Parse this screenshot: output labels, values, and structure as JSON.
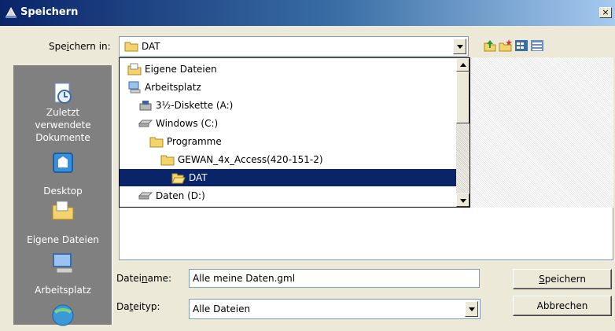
{
  "window": {
    "title": "Speichern",
    "close_glyph": "×",
    "accent_color": "#0a246a"
  },
  "save_in": {
    "label_pre": "Spe",
    "label_key": "i",
    "label_post": "chern in:",
    "current": "DAT"
  },
  "toolbar": {
    "icons": [
      "up-one-level-icon",
      "new-folder-icon",
      "view-menu-icon",
      "view-list-icon"
    ]
  },
  "dropdown": {
    "items": [
      {
        "label": "Eigene Dateien",
        "icon": "my-documents-icon"
      },
      {
        "label": "Arbeitsplatz",
        "icon": "my-computer-icon"
      },
      {
        "label": "3½-Diskette (A:)",
        "icon": "floppy-drive-icon"
      },
      {
        "label": "Windows (C:)",
        "icon": "hard-drive-icon"
      },
      {
        "label": "Programme",
        "icon": "folder-icon"
      },
      {
        "label": "GEWAN_4x_Access(420-151-2)",
        "icon": "folder-icon"
      },
      {
        "label": "DAT",
        "icon": "open-folder-icon",
        "selected": true
      },
      {
        "label": "Daten (D:)",
        "icon": "hard-drive-icon"
      }
    ]
  },
  "places": {
    "items": [
      {
        "label_lines": [
          "Zuletzt",
          "verwendete",
          "Dokumente"
        ],
        "icon": "recent-documents-icon"
      },
      {
        "label_lines": [
          "Desktop"
        ],
        "icon": "desktop-icon"
      },
      {
        "label_lines": [
          "Eigene Dateien"
        ],
        "icon": "my-documents-icon"
      },
      {
        "label_lines": [
          "Arbeitsplatz"
        ],
        "icon": "my-computer-icon"
      },
      {
        "label_lines": [],
        "icon": "network-places-icon"
      }
    ]
  },
  "filename": {
    "label_pre": "Datei",
    "label_key": "n",
    "label_post": "ame:",
    "value": "Alle meine Daten.gml"
  },
  "filetype": {
    "label_pre": "Da",
    "label_key": "t",
    "label_post": "eityp:",
    "value": "Alle Dateien"
  },
  "buttons": {
    "save_key": "S",
    "save_rest": "peichern",
    "cancel": "Abbrechen"
  }
}
